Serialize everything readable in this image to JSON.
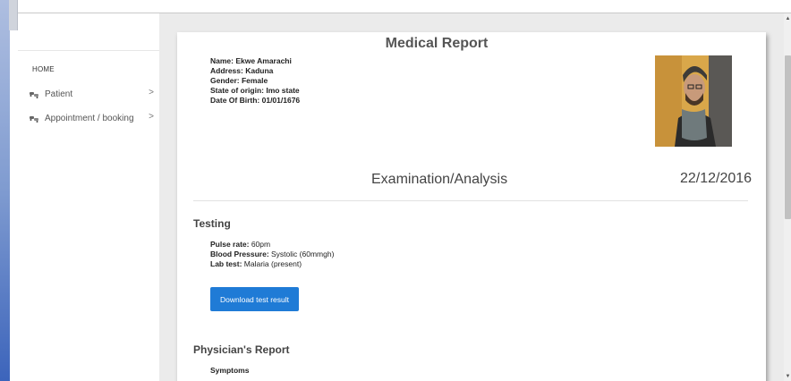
{
  "sidebar": {
    "home_label": "HOME",
    "items": [
      {
        "label": "Patient",
        "icon": "cars-icon",
        "chevron": ">"
      },
      {
        "label": "Appointment / booking",
        "icon": "cars-icon",
        "chevron": ">"
      }
    ]
  },
  "report": {
    "title": "Medical Report",
    "patient": {
      "name": "Name: Ekwe Amarachi",
      "address": "Address: Kaduna",
      "gender": "Gender: Female",
      "state": "State of origin: Imo state",
      "dob": "Date Of Birth: 01/01/1676"
    },
    "exam_title": "Examination/Analysis",
    "exam_date": "22/12/2016"
  },
  "testing": {
    "heading": "Testing",
    "pulse_label": "Pulse rate:",
    "pulse_value": " 60pm",
    "bp_label": "Blood Pressure:",
    "bp_value": " Systolic (60mmgh)",
    "lab_label": "Lab test:",
    "lab_value": " Malaria (present)",
    "download_button": "Download test result"
  },
  "physician": {
    "heading": "Physician's Report",
    "symptoms_label": "Symptoms"
  },
  "colors": {
    "accent_button": "#1f7bd6",
    "background_main": "#ebebeb"
  }
}
